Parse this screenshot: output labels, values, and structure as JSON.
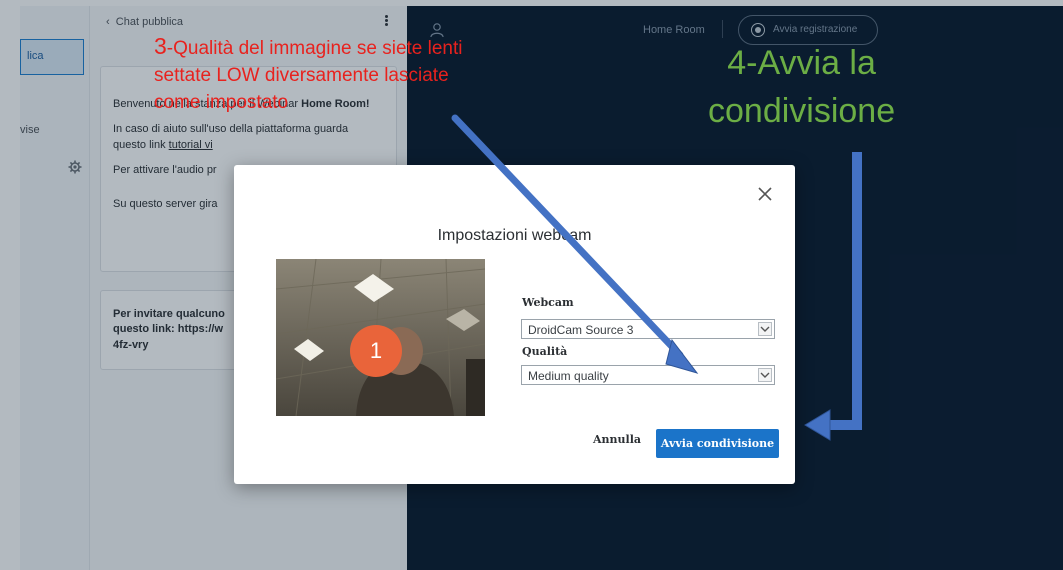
{
  "sidebar": {
    "active_item": "lica",
    "item2": "vise"
  },
  "chat": {
    "header": "Chat pubblica",
    "msg1": {
      "line1_a": "Benvenuto nella stanza per il Webinar ",
      "line1_b": "Home Room!",
      "line2": "In caso di aiuto sull'uso della piattaforma guarda questo link ",
      "link": "tutorial vi",
      "line3": "Per attivare l'audio pr",
      "line4": "Su questo server gira"
    },
    "msg2": {
      "text": "Per invitare qualcuno questo link: https://w 4fz-vry"
    }
  },
  "main": {
    "room_title": "Home Room",
    "record_label": "Avvia registrazione"
  },
  "modal": {
    "title": "Impostazioni webcam",
    "webcam_label": "Webcam",
    "webcam_value": "DroidCam Source 3",
    "quality_label": "Qualità",
    "quality_value": "Medium quality",
    "cancel_label": "Annulla",
    "share_label": "Avvia condivisione"
  },
  "annotations": {
    "red_num": "3",
    "red_text": "-Qualità del immagine se siete lenti settate LOW diversamente lasciate come impostato",
    "green_line1": "4-Avvia la",
    "green_line2": "condivisione",
    "badge": "1"
  },
  "colors": {
    "accent": "#1b74c9",
    "annotation_red": "#e8221e",
    "annotation_green": "#6cae45",
    "arrow_blue": "#4472c4",
    "badge": "#e9643a"
  }
}
